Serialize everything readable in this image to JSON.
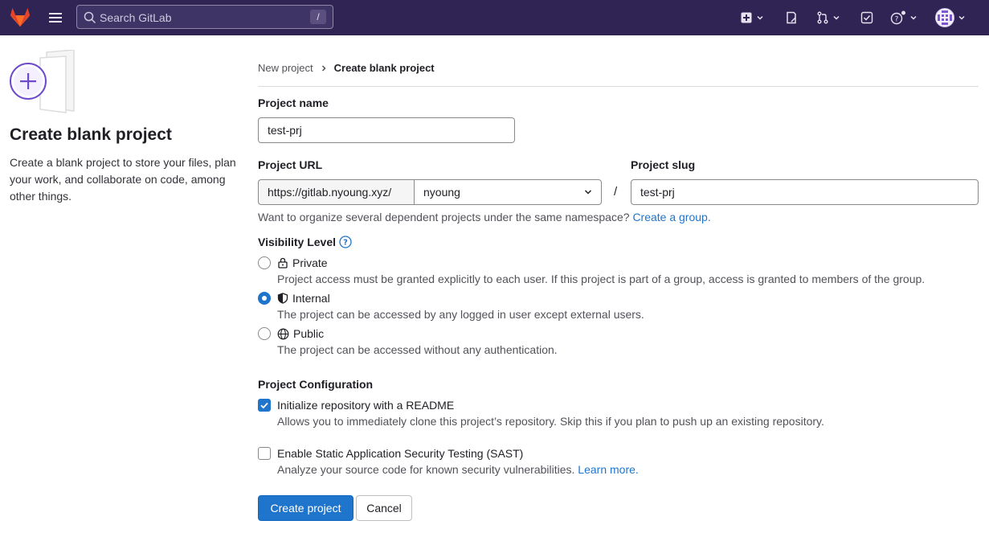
{
  "topbar": {
    "search_placeholder": "Search GitLab",
    "search_shortcut": "/",
    "icons": [
      "gitlab-logo",
      "hamburger-menu-icon",
      "create-new-icon",
      "issues-icon",
      "merge-requests-icon",
      "todos-icon",
      "help-icon",
      "user-avatar"
    ]
  },
  "left": {
    "title": "Create blank project",
    "description": "Create a blank project to store your files, plan your work, and collaborate on code, among other things."
  },
  "breadcrumb": {
    "parent": "New project",
    "current": "Create blank project"
  },
  "form": {
    "project_name_label": "Project name",
    "project_name_value": "test-prj",
    "project_url_label": "Project URL",
    "url_prefix": "https://gitlab.nyoung.xyz/",
    "namespace": "nyoung",
    "slash": "/",
    "project_slug_label": "Project slug",
    "project_slug_value": "test-prj",
    "namespace_help": "Want to organize several dependent projects under the same namespace?",
    "namespace_help_link": "Create a group.",
    "visibility_label": "Visibility Level",
    "visibility_options": [
      {
        "label": "Private",
        "help": "Project access must be granted explicitly to each user. If this project is part of a group, access is granted to members of the group.",
        "checked": false
      },
      {
        "label": "Internal",
        "help": "The project can be accessed by any logged in user except external users.",
        "checked": true
      },
      {
        "label": "Public",
        "help": "The project can be accessed without any authentication.",
        "checked": false
      }
    ],
    "config_label": "Project Configuration",
    "config_options": [
      {
        "label": "Initialize repository with a README",
        "help": "Allows you to immediately clone this project’s repository. Skip this if you plan to push up an existing repository.",
        "checked": true
      },
      {
        "label": "Enable Static Application Security Testing (SAST)",
        "help": "Analyze your source code for known security vulnerabilities.",
        "link": "Learn more.",
        "checked": false
      }
    ],
    "create_button": "Create project",
    "cancel_button": "Cancel"
  },
  "colors": {
    "nav_bg": "#2f2454",
    "primary": "#1f75cb",
    "brand_orange": "#fc6d26"
  }
}
